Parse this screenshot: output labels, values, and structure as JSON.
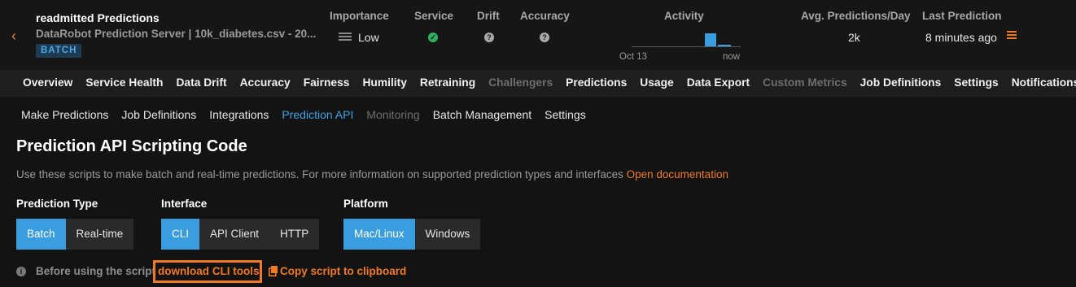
{
  "header": {
    "deployment_name": "readmitted Predictions",
    "deployment_subtitle": "DataRobot Prediction Server | 10k_diabetes.csv - 20...",
    "badge": "BATCH",
    "columns": {
      "importance": {
        "label": "Importance",
        "value": "Low"
      },
      "service": {
        "label": "Service",
        "status": "ok",
        "color": "#2fb360"
      },
      "drift": {
        "label": "Drift",
        "status": "unknown"
      },
      "accuracy": {
        "label": "Accuracy",
        "status": "unknown"
      },
      "activity": {
        "label": "Activity",
        "start_tick": "Oct 13",
        "end_tick": "now"
      },
      "avg_predictions": {
        "label": "Avg. Predictions/Day",
        "value": "2k"
      },
      "last_prediction": {
        "label": "Last Prediction",
        "value": "8 minutes ago"
      }
    }
  },
  "tabs": [
    {
      "label": "Overview",
      "enabled": true
    },
    {
      "label": "Service Health",
      "enabled": true
    },
    {
      "label": "Data Drift",
      "enabled": true
    },
    {
      "label": "Accuracy",
      "enabled": true
    },
    {
      "label": "Fairness",
      "enabled": true
    },
    {
      "label": "Humility",
      "enabled": true
    },
    {
      "label": "Retraining",
      "enabled": true
    },
    {
      "label": "Challengers",
      "enabled": false
    },
    {
      "label": "Predictions",
      "enabled": true
    },
    {
      "label": "Usage",
      "enabled": true
    },
    {
      "label": "Data Export",
      "enabled": true
    },
    {
      "label": "Custom Metrics",
      "enabled": false
    },
    {
      "label": "Job Definitions",
      "enabled": true
    },
    {
      "label": "Settings",
      "enabled": true
    },
    {
      "label": "Notifications",
      "enabled": true
    }
  ],
  "subnav": [
    {
      "label": "Make Predictions",
      "state": "normal"
    },
    {
      "label": "Job Definitions",
      "state": "normal"
    },
    {
      "label": "Integrations",
      "state": "normal"
    },
    {
      "label": "Prediction API",
      "state": "active"
    },
    {
      "label": "Monitoring",
      "state": "disabled"
    },
    {
      "label": "Batch Management",
      "state": "normal"
    },
    {
      "label": "Settings",
      "state": "normal"
    }
  ],
  "page": {
    "title": "Prediction API Scripting Code",
    "description": "Use these scripts to make batch and real-time predictions. For more information on supported prediction types and interfaces ",
    "doc_link": "Open documentation"
  },
  "options": {
    "prediction_type": {
      "label": "Prediction Type",
      "choices": [
        "Batch",
        "Real-time"
      ],
      "selected": "Batch"
    },
    "interface": {
      "label": "Interface",
      "choices": [
        "CLI",
        "API Client",
        "HTTP"
      ],
      "selected": "CLI"
    },
    "platform": {
      "label": "Platform",
      "choices": [
        "Mac/Linux",
        "Windows"
      ],
      "selected": "Mac/Linux"
    }
  },
  "info": {
    "text": "Before using the script",
    "download_link": "download CLI tools",
    "copy_link": "Copy script to clipboard"
  },
  "colors": {
    "accent": "#f07a24",
    "primary": "#3a9de0",
    "background": "#131313"
  }
}
